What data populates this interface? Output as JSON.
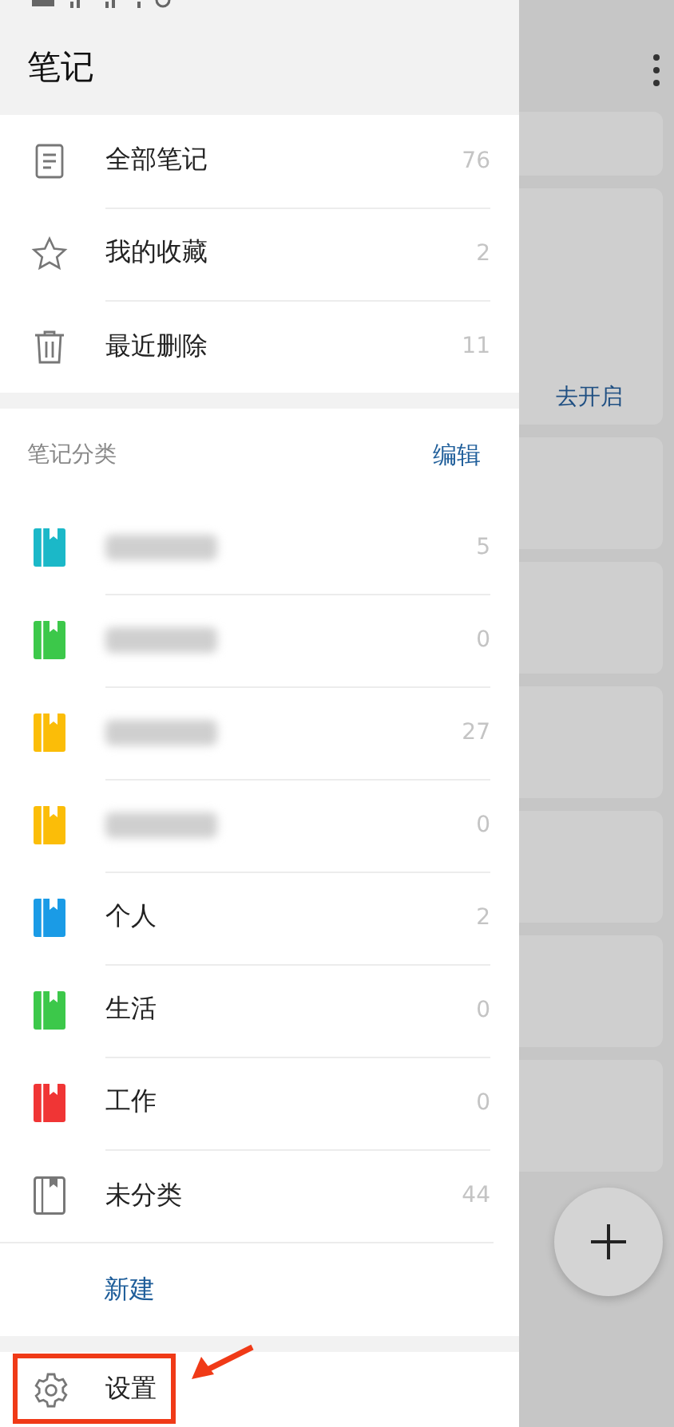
{
  "drawer": {
    "title": "笔记",
    "main_items": [
      {
        "kind": "document",
        "label": "全部笔记",
        "count": "76"
      },
      {
        "kind": "star",
        "label": "我的收藏",
        "count": "2"
      },
      {
        "kind": "trash",
        "label": "最近删除",
        "count": "11"
      }
    ],
    "categories_header": {
      "title": "笔记分类",
      "action": "编辑"
    },
    "categories": [
      {
        "kind": "notebook",
        "redacted": true,
        "color": "#1bb8c8",
        "count": "5"
      },
      {
        "kind": "notebook",
        "redacted": true,
        "color": "#3cc84a",
        "count": "0"
      },
      {
        "kind": "notebook",
        "redacted": true,
        "color": "#fbbd08",
        "count": "27"
      },
      {
        "kind": "notebook",
        "redacted": true,
        "color": "#fbbd08",
        "count": "0"
      },
      {
        "kind": "notebook",
        "redacted": false,
        "label": "个人",
        "color": "#1a9be6",
        "count": "2"
      },
      {
        "kind": "notebook",
        "redacted": false,
        "label": "生活",
        "color": "#3cc84a",
        "count": "0"
      },
      {
        "kind": "notebook",
        "redacted": false,
        "label": "工作",
        "color": "#f03535",
        "count": "0"
      },
      {
        "kind": "uncategorized",
        "redacted": false,
        "label": "未分类",
        "count": "44"
      }
    ],
    "new_button": "新建",
    "settings": "设置"
  },
  "background": {
    "link": "去开启"
  },
  "annotation": {
    "kind": "box-and-arrow"
  }
}
